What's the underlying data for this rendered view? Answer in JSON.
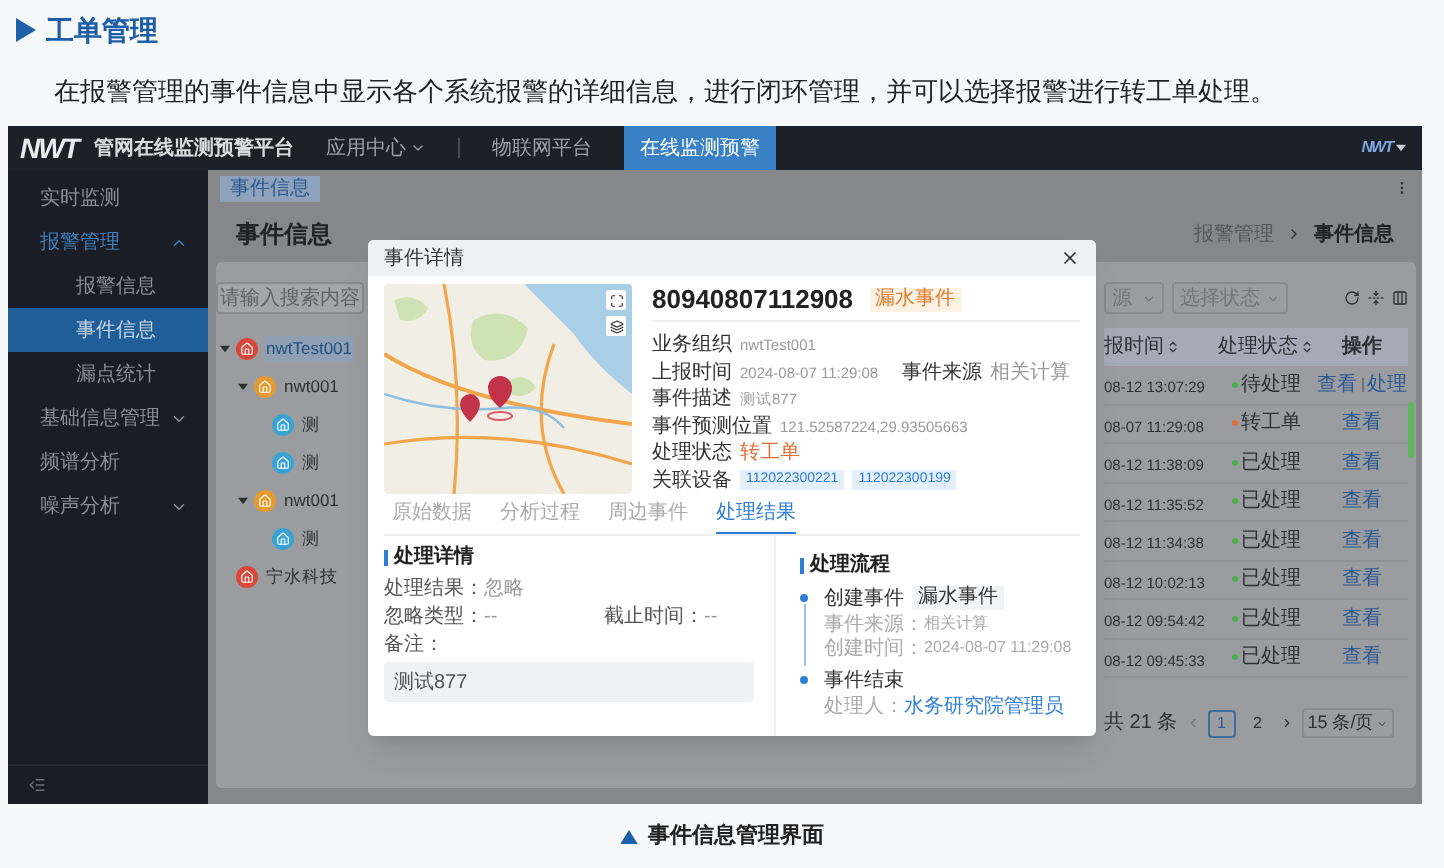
{
  "heading": "工单管理",
  "intro": "在报警管理的事件信息中显示各个系统报警的详细信息，进行闭环管理，并可以选择报警进行转工单处理。",
  "app": {
    "logo": "NWT",
    "title": "管网在线监测预警平台",
    "nav": [
      {
        "label": "应用中心",
        "kind": "dropdown",
        "selected": false
      },
      {
        "label": "物联网平台",
        "kind": "link",
        "selected": false
      },
      {
        "label": "在线监测预警",
        "kind": "link",
        "selected": true
      }
    ],
    "user_logo": "NWT",
    "sidebar": [
      {
        "label": "实时监测",
        "selected": false
      },
      {
        "label": "报警管理",
        "selected": false,
        "expanded": true,
        "children": [
          {
            "label": "报警信息",
            "selected": false
          },
          {
            "label": "事件信息",
            "selected": true
          },
          {
            "label": "漏点统计",
            "selected": false
          }
        ]
      },
      {
        "label": "基础信息管理",
        "selected": false,
        "expanded": false
      },
      {
        "label": "频谱分析",
        "selected": false
      },
      {
        "label": "噪声分析",
        "selected": false,
        "expanded": false
      }
    ],
    "page_tab": "事件信息",
    "page_title": "事件信息",
    "breadcrumb": [
      "报警管理",
      "事件信息"
    ],
    "tree_search": {
      "placeholder": "请输入搜索内容"
    },
    "tree": [
      {
        "label": "nwtTest001",
        "color": "#d9473b",
        "selected": true,
        "expanded": true,
        "children": [
          {
            "label": "nwt001",
            "color": "#e49a2e",
            "selected": false,
            "expanded": true,
            "children": [
              {
                "label": "测",
                "color": "#3aa3d4",
                "selected": false
              },
              {
                "label": "测",
                "color": "#3aa3d4",
                "selected": false
              }
            ]
          },
          {
            "label": "nwt001",
            "color": "#e49a2e",
            "selected": false,
            "expanded": true,
            "children": [
              {
                "label": "测",
                "color": "#3aa3d4",
                "selected": false
              }
            ]
          }
        ]
      },
      {
        "label": "宁水科技",
        "color": "#d9473b",
        "selected": false
      }
    ],
    "filters": [
      {
        "placeholder": "源"
      },
      {
        "placeholder": "选择状态"
      }
    ],
    "table": {
      "columns": [
        {
          "label": "报时间",
          "sortable": true
        },
        {
          "label": "处理状态",
          "sortable": true
        },
        {
          "label": "操作",
          "sortable": false
        }
      ],
      "rows": [
        {
          "time": "08-12 13:07:29",
          "status": "待处理",
          "color": "#4caf50",
          "actions": [
            "查看",
            "处理"
          ]
        },
        {
          "time": "08-07 11:29:08",
          "status": "转工单",
          "color": "#e0703a",
          "actions": [
            "查看"
          ]
        },
        {
          "time": "08-12 11:38:09",
          "status": "已处理",
          "color": "#4caf50",
          "actions": [
            "查看"
          ]
        },
        {
          "time": "08-12 11:35:52",
          "status": "已处理",
          "color": "#4caf50",
          "actions": [
            "查看"
          ]
        },
        {
          "time": "08-12 11:34:38",
          "status": "已处理",
          "color": "#4caf50",
          "actions": [
            "查看"
          ]
        },
        {
          "time": "08-12 10:02:13",
          "status": "已处理",
          "color": "#4caf50",
          "actions": [
            "查看"
          ]
        },
        {
          "time": "08-12 09:54:42",
          "status": "已处理",
          "color": "#4caf50",
          "actions": [
            "查看"
          ]
        },
        {
          "time": "08-12 09:45:33",
          "status": "已处理",
          "color": "#4caf50",
          "actions": [
            "查看"
          ]
        }
      ]
    },
    "pagination": {
      "total": "共 21 条",
      "pages": [
        {
          "label": "1",
          "selected": true
        },
        {
          "label": "2",
          "selected": false
        }
      ],
      "page_size": "15 条/页"
    }
  },
  "modal": {
    "title": "事件详情",
    "event_id": "80940807112908",
    "event_tag": "漏水事件",
    "fields": [
      {
        "kind": "text",
        "label": "业务组织",
        "value": "nwtTest001"
      },
      {
        "kind": "pair",
        "label": "上报时间",
        "value": "2024-08-07 11:29:08",
        "extra_label": "事件来源",
        "extra_value": "相关计算"
      },
      {
        "kind": "text",
        "label": "事件描述",
        "value": "测试877"
      },
      {
        "kind": "text",
        "label": "事件预测位置",
        "value": "121.52587224,29.93505663"
      },
      {
        "kind": "status",
        "label": "处理状态",
        "value": "转工单"
      },
      {
        "kind": "devices",
        "label": "关联设备",
        "devices": [
          "112022300221",
          "112022300199"
        ]
      }
    ],
    "tabs": [
      {
        "label": "原始数据",
        "selected": false
      },
      {
        "label": "分析过程",
        "selected": false
      },
      {
        "label": "周边事件",
        "selected": false
      },
      {
        "label": "处理结果",
        "selected": true
      }
    ],
    "result": {
      "title": "处理详情",
      "result_label": "处理结果：",
      "result_value": "忽略",
      "type_label": "忽略类型：",
      "type_value": "--",
      "deadline_label": "截止时间：",
      "deadline_value": "--",
      "note_label": "备注：",
      "note": "测试877"
    },
    "flow": {
      "title": "处理流程",
      "steps": [
        {
          "title": "创建事件",
          "tag": "漏水事件",
          "details": [
            {
              "kind": "text",
              "label": "事件来源：",
              "value": "相关计算"
            },
            {
              "kind": "text",
              "label": "创建时间：",
              "value": "2024-08-07 11:29:08"
            }
          ]
        },
        {
          "title": "事件结束",
          "details": [
            {
              "kind": "link",
              "label": "处理人：",
              "value": "水务研究院管理员"
            }
          ]
        }
      ]
    }
  },
  "caption": "事件信息管理界面"
}
